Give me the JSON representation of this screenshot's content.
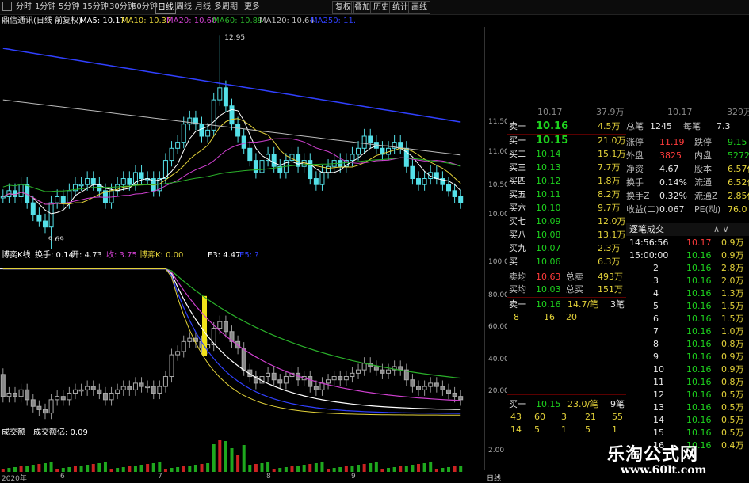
{
  "toolbar": {
    "left_items": [
      "分时",
      "1分钟",
      "5分钟",
      "15分钟",
      "30分钟",
      "60分钟",
      "日线",
      "周线",
      "月线",
      "多周期",
      "更多"
    ],
    "active": "日线",
    "right_items": [
      "复权",
      "叠加",
      "历史",
      "统计",
      "画线"
    ]
  },
  "legend_main": {
    "stock": "鼎信通讯(日线 前复权)",
    "ma5": "MA5: 10.17",
    "ma10": "MA10: 10.37",
    "ma20": "MA20: 10.60",
    "ma60": "MA60: 10.89",
    "ma120": "MA120: 10.64",
    "ma250": "MA250: 11.",
    "high_label": "12.95",
    "low_label": "9.69"
  },
  "legend_indicator": {
    "name": "博奕K线",
    "v1": "换手: 0.14",
    "v2": "开: 4.73",
    "v3": "收: 3.75",
    "v4": "博弈K: 0.00",
    "v5": "E3: 4.47",
    "v6": "E5: ?"
  },
  "legend_volume": {
    "name": "成交额",
    "v1": "成交额亿: 0.09"
  },
  "colors": {
    "up": "#ff3b3b",
    "down": "#1ed31e",
    "candle_up": "#54e0e8",
    "ma5": "#ffffff",
    "ma10": "#e3d23a",
    "ma20": "#d040d0",
    "ma60": "#2ab02a",
    "ma120": "#bbbbbb",
    "ma250": "#3040ff"
  },
  "price_axis": [
    "11.50",
    "11.00",
    "10.50",
    "10.00"
  ],
  "indicator_axis": [
    "100.0",
    "80.00",
    "60.00",
    "40.00",
    "20.00"
  ],
  "volume_axis": [
    "2.00"
  ],
  "date_axis": [
    "2020年",
    "6",
    "7",
    "8",
    "9"
  ],
  "date_axis_tail": "日线",
  "top_quote": {
    "r0": {
      "label": "卖一",
      "price": "10.16",
      "vol": "4.5万",
      "l2": "总笔",
      "v2": "1245",
      "l3": "每笔",
      "v3": "7.3"
    }
  },
  "partial_top": {
    "a": "10.17",
    "b": "37.9万",
    "c": "10.17",
    "d": "329万"
  },
  "bids": [
    {
      "label": "买一",
      "price": "10.15",
      "vol": "21.0万"
    },
    {
      "label": "买二",
      "price": "10.14",
      "vol": "15.1万"
    },
    {
      "label": "买三",
      "price": "10.13",
      "vol": "7.7万"
    },
    {
      "label": "买四",
      "price": "10.12",
      "vol": "1.8万"
    },
    {
      "label": "买五",
      "price": "10.11",
      "vol": "8.2万"
    },
    {
      "label": "买六",
      "price": "10.10",
      "vol": "9.7万"
    },
    {
      "label": "买七",
      "price": "10.09",
      "vol": "12.0万"
    },
    {
      "label": "买八",
      "price": "10.08",
      "vol": "13.1万"
    },
    {
      "label": "买九",
      "price": "10.07",
      "vol": "2.3万"
    },
    {
      "label": "买十",
      "price": "10.06",
      "vol": "6.3万"
    }
  ],
  "avg": {
    "l1": "卖均",
    "v1": "10.63",
    "l1b": "总卖",
    "v1b": "493万",
    "l2": "买均",
    "v2": "10.03",
    "l2b": "总买",
    "v2b": "151万"
  },
  "sell_line": {
    "label": "卖一",
    "price": "10.16",
    "vol": "14.7/笔",
    "cnt": "3笔",
    "q": [
      "8",
      "16",
      "20"
    ]
  },
  "buy_line": {
    "label": "买一",
    "price": "10.15",
    "vol": "23.0/笔",
    "cnt": "9笔",
    "q1": [
      "43",
      "60",
      "3",
      "21",
      "55"
    ],
    "q2": [
      "14",
      "5",
      "1",
      "5",
      "1"
    ]
  },
  "stats": [
    {
      "l": "涨停",
      "v": "11.19",
      "l2": "跌停",
      "v2": "9.15"
    },
    {
      "l": "外盘",
      "v": "3825",
      "l2": "内盘",
      "v2": "5272"
    },
    {
      "l": "净资",
      "v": "4.67",
      "l2": "股本",
      "v2": "6.57亿"
    },
    {
      "l": "换手",
      "v": "0.14%",
      "l2": "流通",
      "v2": "6.52亿"
    },
    {
      "l": "换手Z",
      "v": "0.32%",
      "l2": "流通Z",
      "v2": "2.85亿"
    },
    {
      "l": "收益(二)",
      "v": "0.067",
      "l2": "PE(动)",
      "v2": "76.0"
    }
  ],
  "trades_header": {
    "title": "逐笔成交",
    "arrows": "∧ ∨"
  },
  "trades": [
    {
      "t": "14:56:56",
      "p": "10.17",
      "v": "0.9万"
    },
    {
      "t": "15:00:00",
      "p": "10.16",
      "v": "0.9万"
    },
    {
      "t": "2",
      "p": "10.16",
      "v": "2.8万"
    },
    {
      "t": "3",
      "p": "10.16",
      "v": "2.0万"
    },
    {
      "t": "4",
      "p": "10.16",
      "v": "1.3万"
    },
    {
      "t": "5",
      "p": "10.16",
      "v": "1.5万"
    },
    {
      "t": "6",
      "p": "10.16",
      "v": "1.5万"
    },
    {
      "t": "7",
      "p": "10.16",
      "v": "1.0万"
    },
    {
      "t": "8",
      "p": "10.16",
      "v": "0.8万"
    },
    {
      "t": "9",
      "p": "10.16",
      "v": "0.9万"
    },
    {
      "t": "10",
      "p": "10.16",
      "v": "0.9万"
    },
    {
      "t": "11",
      "p": "10.16",
      "v": "0.8万"
    },
    {
      "t": "12",
      "p": "10.16",
      "v": "0.5万"
    },
    {
      "t": "13",
      "p": "10.16",
      "v": "0.5万"
    },
    {
      "t": "14",
      "p": "10.16",
      "v": "0.5万"
    },
    {
      "t": "15",
      "p": "10.16",
      "v": "0.5万"
    },
    {
      "t": "16",
      "p": "10.16",
      "v": "0.4万"
    }
  ],
  "watermark": {
    "line1": "乐淘公式网",
    "line2": "www.60lt.com"
  },
  "chart_data": {
    "type": "candlestick",
    "note": "daily price chart, values approximate",
    "ylim": [
      9.6,
      13.0
    ],
    "close": [
      10.3,
      10.4,
      10.3,
      10.5,
      10.2,
      10.0,
      9.9,
      9.8,
      10.2,
      10.3,
      10.2,
      10.4,
      10.5,
      10.5,
      10.6,
      10.5,
      10.4,
      10.2,
      10.4,
      10.5,
      10.6,
      10.5,
      10.7,
      10.6,
      10.6,
      10.4,
      10.6,
      10.9,
      11.1,
      11.2,
      11.5,
      11.6,
      11.5,
      11.3,
      11.4,
      11.9,
      12.1,
      11.8,
      11.5,
      11.3,
      11.1,
      10.9,
      10.7,
      10.9,
      11.0,
      10.8,
      10.7,
      10.9,
      11.0,
      10.8,
      10.9,
      10.6,
      10.5,
      10.7,
      10.8,
      10.9,
      10.8,
      10.9,
      11.0,
      11.1,
      11.3,
      11.2,
      11.1,
      11.0,
      11.1,
      11.2,
      11.1,
      10.8,
      10.6,
      10.5,
      10.6,
      10.7,
      10.6,
      10.5,
      10.4,
      10.3,
      10.2
    ]
  }
}
